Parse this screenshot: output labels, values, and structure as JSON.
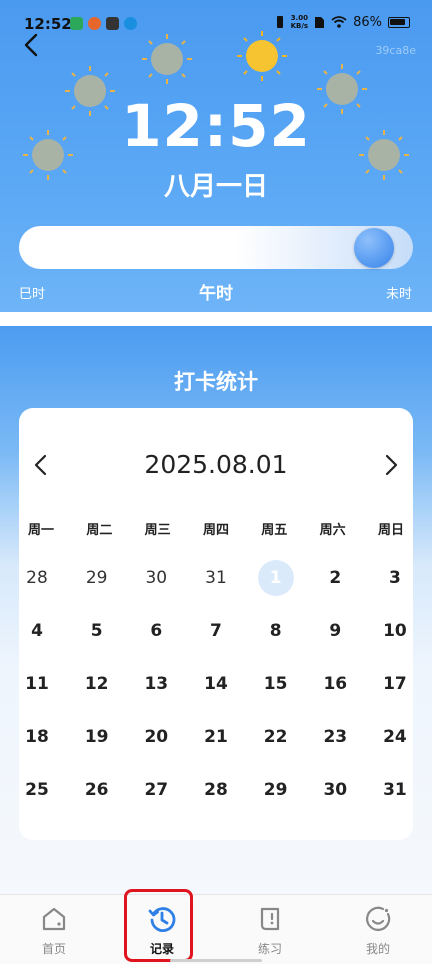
{
  "status_bar": {
    "time": "12:52",
    "net_speed_value": "3.00",
    "net_speed_unit": "KB/s",
    "battery": "86%"
  },
  "header": {
    "watermark": "39ca8e"
  },
  "clock": {
    "time": "12:52",
    "date": "八月一日"
  },
  "shichen": {
    "left": "巳时",
    "current": "午时",
    "right": "未时",
    "progress": 0.95
  },
  "stats": {
    "title": "打卡统计"
  },
  "calendar": {
    "month": "2025.08.01",
    "weekdays": [
      "周一",
      "周二",
      "周三",
      "周四",
      "周五",
      "周六",
      "周日"
    ],
    "rows": [
      [
        "28",
        "29",
        "30",
        "31",
        "1",
        "2",
        "3"
      ],
      [
        "4",
        "5",
        "6",
        "7",
        "8",
        "9",
        "10"
      ],
      [
        "11",
        "12",
        "13",
        "14",
        "15",
        "16",
        "17"
      ],
      [
        "18",
        "19",
        "20",
        "21",
        "22",
        "23",
        "24"
      ],
      [
        "25",
        "26",
        "27",
        "28",
        "29",
        "30",
        "31"
      ]
    ],
    "selected_day": "1"
  },
  "nav": {
    "items": [
      {
        "label": "首页"
      },
      {
        "label": "记录"
      },
      {
        "label": "练习"
      },
      {
        "label": "我的"
      }
    ]
  },
  "colors": {
    "accent": "#2f80e6",
    "highlight": "#e0141e"
  }
}
